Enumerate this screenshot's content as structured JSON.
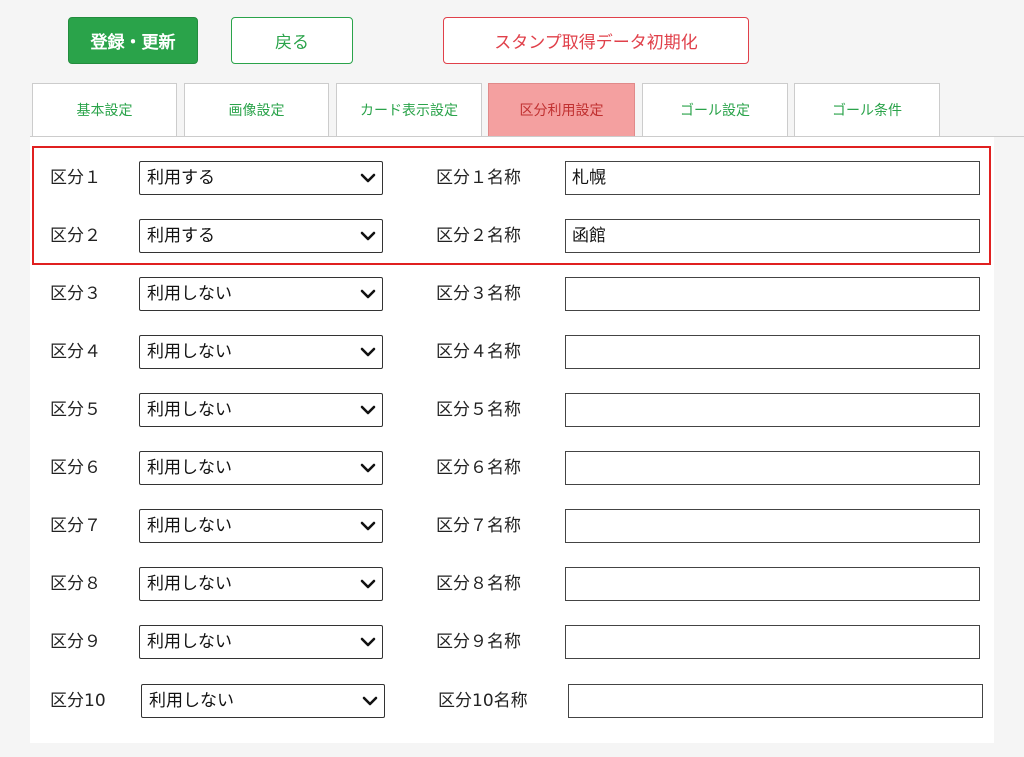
{
  "toolbar": {
    "register_label": "登録・更新",
    "back_label": "戻る",
    "reset_label": "スタンプ取得データ初期化"
  },
  "tabs": [
    {
      "label": "基本設定",
      "active": false
    },
    {
      "label": "画像設定",
      "active": false
    },
    {
      "label": "カード表示設定",
      "active": false
    },
    {
      "label": "区分利用設定",
      "active": true
    },
    {
      "label": "ゴール設定",
      "active": false
    },
    {
      "label": "ゴール条件",
      "active": false
    }
  ],
  "colors": {
    "primary_green": "#2aa34a",
    "danger_red": "#e0404a",
    "active_tab_bg": "#f4a0a0",
    "highlight_border": "#e02020"
  },
  "divisions": [
    {
      "label": "区分１",
      "usage": "利用する",
      "name_label": "区分１名称",
      "name_value": "札幌"
    },
    {
      "label": "区分２",
      "usage": "利用する",
      "name_label": "区分２名称",
      "name_value": "函館"
    },
    {
      "label": "区分３",
      "usage": "利用しない",
      "name_label": "区分３名称",
      "name_value": ""
    },
    {
      "label": "区分４",
      "usage": "利用しない",
      "name_label": "区分４名称",
      "name_value": ""
    },
    {
      "label": "区分５",
      "usage": "利用しない",
      "name_label": "区分５名称",
      "name_value": ""
    },
    {
      "label": "区分６",
      "usage": "利用しない",
      "name_label": "区分６名称",
      "name_value": ""
    },
    {
      "label": "区分７",
      "usage": "利用しない",
      "name_label": "区分７名称",
      "name_value": ""
    },
    {
      "label": "区分８",
      "usage": "利用しない",
      "name_label": "区分８名称",
      "name_value": ""
    },
    {
      "label": "区分９",
      "usage": "利用しない",
      "name_label": "区分９名称",
      "name_value": ""
    },
    {
      "label": "区分10",
      "usage": "利用しない",
      "name_label": "区分10名称",
      "name_value": ""
    }
  ]
}
